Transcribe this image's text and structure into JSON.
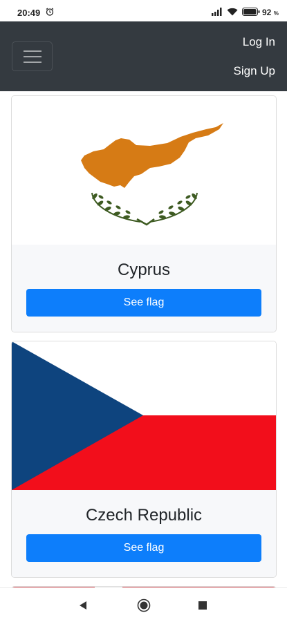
{
  "status_bar": {
    "time": "20:49",
    "battery_level": "92",
    "battery_unit": "%"
  },
  "navbar": {
    "login_label": "Log In",
    "signup_label": "Sign Up"
  },
  "cards": [
    {
      "title": "Cyprus",
      "button_label": "See flag",
      "flag_colors": {
        "land": "#d67b15",
        "wreath": "#3e5b22",
        "background": "#ffffff"
      }
    },
    {
      "title": "Czech Republic",
      "button_label": "See flag",
      "flag_colors": {
        "triangle": "#0e447e",
        "top": "#ffffff",
        "bottom": "#f20e1b"
      }
    }
  ],
  "colors": {
    "navbar": "#343a40",
    "button": "#0d7efb",
    "card_body": "#f7f8fa"
  }
}
